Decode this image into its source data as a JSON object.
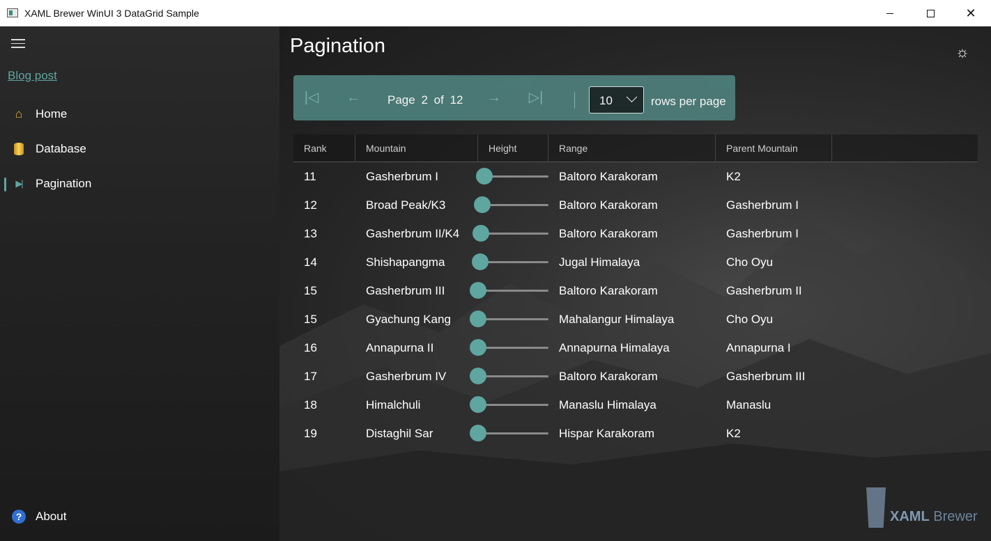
{
  "window": {
    "title": "XAML Brewer WinUI 3 DataGrid Sample",
    "controls": {
      "minimize": "minimize-icon",
      "maximize": "maximize-icon",
      "close": "close-icon"
    }
  },
  "sidebar": {
    "blog_link": "Blog post",
    "items": [
      {
        "label": "Home",
        "icon": "home-icon"
      },
      {
        "label": "Database",
        "icon": "database-icon"
      },
      {
        "label": "Pagination",
        "icon": "pagination-icon",
        "selected": true
      }
    ],
    "footer_item": {
      "label": "About",
      "icon": "help-icon"
    }
  },
  "page": {
    "title": "Pagination"
  },
  "pager": {
    "page_word": "Page",
    "current_page": "2",
    "of_word": "of",
    "total_pages": "12",
    "rows_per_page": "10",
    "rows_label": "rows per page"
  },
  "grid": {
    "columns": [
      "Rank",
      "Mountain",
      "Height",
      "Range",
      "Parent Mountain"
    ],
    "height_range": [
      8000,
      8900
    ],
    "rows": [
      {
        "rank": "11",
        "mountain": "Gasherbrum I",
        "height": 8080,
        "range": "Baltoro Karakoram",
        "parent": "K2"
      },
      {
        "rank": "12",
        "mountain": "Broad Peak/K3",
        "height": 8051,
        "range": "Baltoro Karakoram",
        "parent": "Gasherbrum I"
      },
      {
        "rank": "13",
        "mountain": "Gasherbrum II/K4",
        "height": 8035,
        "range": "Baltoro Karakoram",
        "parent": "Gasherbrum I"
      },
      {
        "rank": "14",
        "mountain": "Shishapangma",
        "height": 8027,
        "range": "Jugal Himalaya",
        "parent": "Cho Oyu"
      },
      {
        "rank": "15",
        "mountain": "Gasherbrum III",
        "height": 7952,
        "range": "Baltoro Karakoram",
        "parent": "Gasherbrum II"
      },
      {
        "rank": "15",
        "mountain": "Gyachung Kang",
        "height": 7952,
        "range": "Mahalangur Himalaya",
        "parent": "Cho Oyu"
      },
      {
        "rank": "16",
        "mountain": "Annapurna II",
        "height": 7937,
        "range": "Annapurna Himalaya",
        "parent": "Annapurna I"
      },
      {
        "rank": "17",
        "mountain": "Gasherbrum IV",
        "height": 7932,
        "range": "Baltoro Karakoram",
        "parent": "Gasherbrum III"
      },
      {
        "rank": "18",
        "mountain": "Himalchuli",
        "height": 7893,
        "range": "Manaslu Himalaya",
        "parent": "Manaslu"
      },
      {
        "rank": "19",
        "mountain": "Distaghil Sar",
        "height": 7885,
        "range": "Hispar Karakoram",
        "parent": "K2"
      }
    ]
  },
  "brand": {
    "word_bold": "XAML",
    "word_light": "Brewer"
  },
  "colors": {
    "accent": "#5fa5a0",
    "pager_bg": "#4d7d79"
  }
}
